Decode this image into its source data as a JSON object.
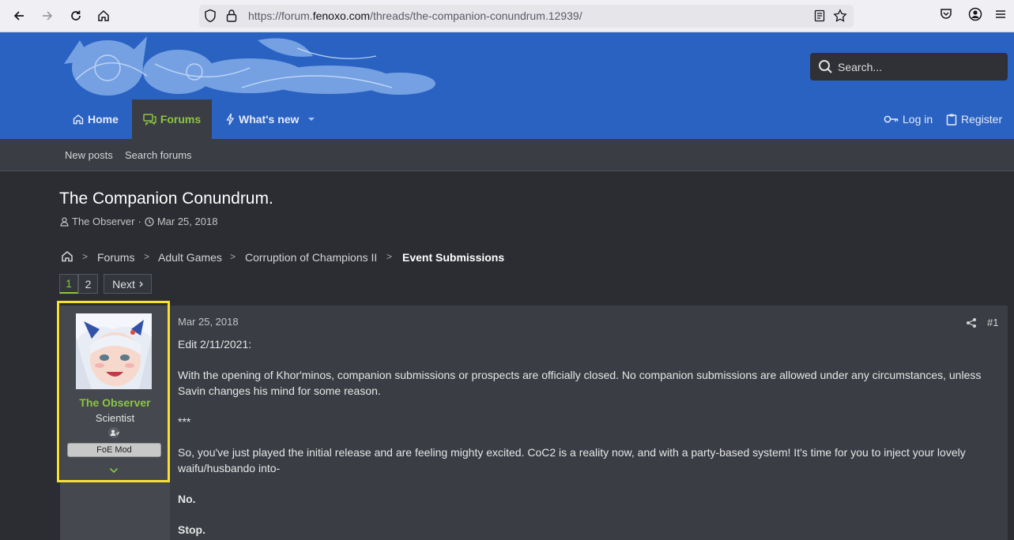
{
  "browser": {
    "url_prefix": "https://forum.",
    "url_host": "fenoxo.com",
    "url_path": "/threads/the-companion-conundrum.12939/"
  },
  "header": {
    "search_placeholder": "Search...",
    "nav": {
      "home": "Home",
      "forums": "Forums",
      "whats_new": "What's new",
      "login": "Log in",
      "register": "Register"
    }
  },
  "subnav": {
    "new_posts": "New posts",
    "search_forums": "Search forums"
  },
  "thread": {
    "title": "The Companion Conundrum.",
    "author": "The Observer",
    "date": "Mar 25, 2018",
    "separator": "·"
  },
  "breadcrumb": {
    "items": [
      "Forums",
      "Adult Games",
      "Corruption of Champions II",
      "Event Submissions"
    ]
  },
  "pagination": {
    "pages": [
      "1",
      "2"
    ],
    "current": "1",
    "next": "Next"
  },
  "post": {
    "date": "Mar 25, 2018",
    "number": "#1",
    "user": {
      "name": "The Observer",
      "title": "Scientist",
      "banner": "FoE Mod"
    },
    "paragraphs": [
      "Edit 2/11/2021:",
      "With the opening of Khor'minos, companion submissions or prospects are officially closed. No companion submissions are allowed under any circumstances, unless Savin changes his mind for some reason.",
      "***",
      "So, you've just played the initial release and are feeling mighty excited. CoC2 is a reality now, and with a party-based system! It's time for you to inject your lovely waifu/husbando into-",
      "No.",
      "Stop."
    ]
  },
  "colors": {
    "header_blue": "#2a62c2",
    "accent_green": "#8cc63f",
    "highlight_yellow": "#f5e12e",
    "page_bg": "#2b2d33"
  }
}
